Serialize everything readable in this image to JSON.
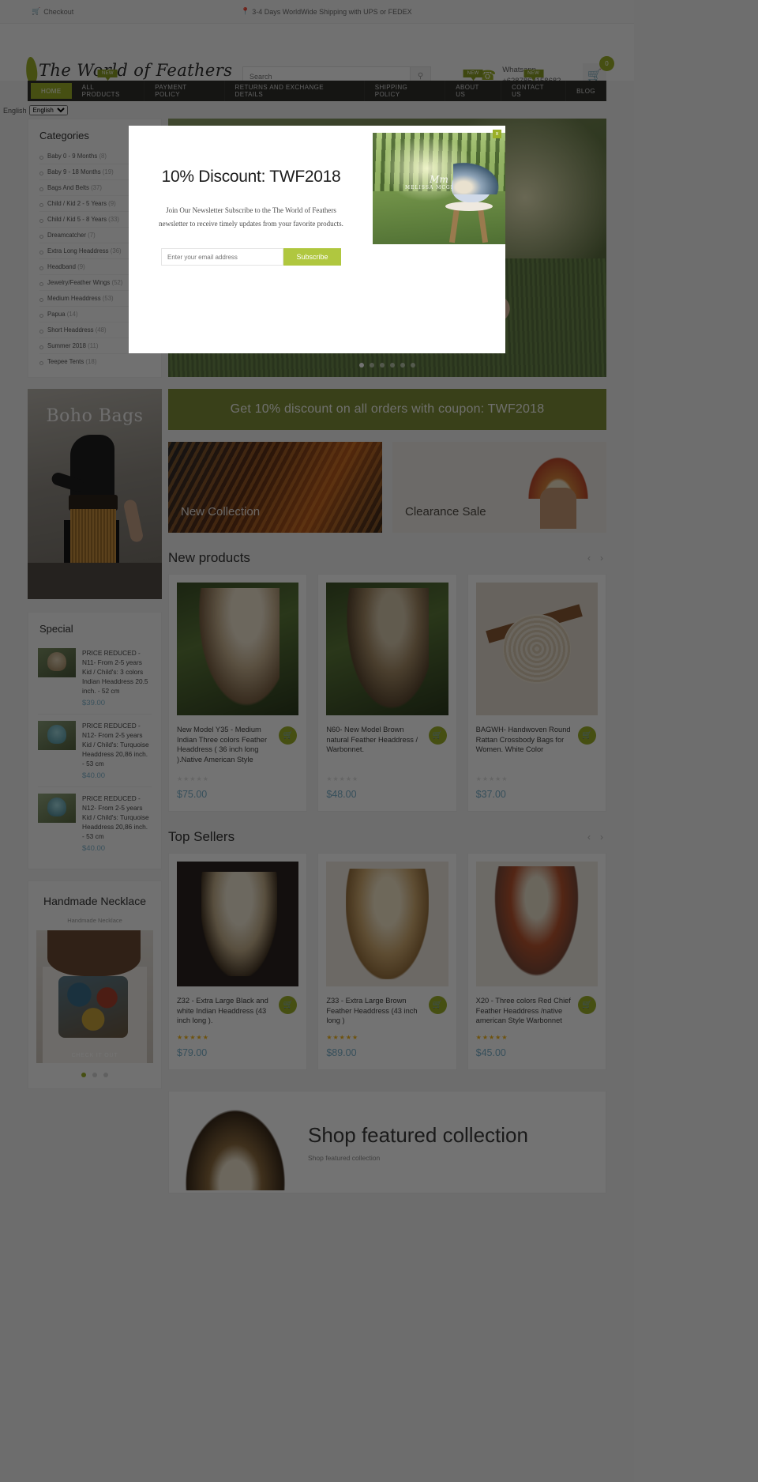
{
  "colors": {
    "accent": "#9bb029",
    "price": "#79b0cb",
    "nav_bg": "#2f2f2c",
    "subscribe": "#b0c73f"
  },
  "topbar": {
    "checkout": "Checkout",
    "shipping_notice": "3-4 Days WorldWide Shipping with UPS or FEDEX"
  },
  "header": {
    "brand": "The World of Feathers",
    "search_placeholder": "Search",
    "whatsapp_label": "Whatsapp",
    "whatsapp_number": "+6287862158682",
    "cart_count": "0"
  },
  "nav": {
    "items": [
      {
        "label": "HOME",
        "active": true,
        "flag": ""
      },
      {
        "label": "ALL PRODUCTS",
        "active": false,
        "flag": "NEW"
      },
      {
        "label": "PAYMENT POLICY",
        "active": false,
        "flag": ""
      },
      {
        "label": "RETURNS AND EXCHANGE DETAILS",
        "active": false,
        "flag": ""
      },
      {
        "label": "SHIPPING POLICY",
        "active": false,
        "flag": ""
      },
      {
        "label": "ABOUT US",
        "active": false,
        "flag": "NEW"
      },
      {
        "label": "CONTACT US",
        "active": false,
        "flag": "NEW"
      },
      {
        "label": "BLOG",
        "active": false,
        "flag": ""
      }
    ]
  },
  "language": {
    "label": "English",
    "options": [
      "English"
    ]
  },
  "sidebar": {
    "categories_title": "Categories",
    "categories": [
      {
        "label": "Baby 0 - 9 Months",
        "count": "(8)"
      },
      {
        "label": "Baby 9 - 18 Months",
        "count": "(19)"
      },
      {
        "label": "Bags And Belts",
        "count": "(37)"
      },
      {
        "label": "Child / Kid 2 - 5 Years",
        "count": "(9)"
      },
      {
        "label": "Child / Kid 5 - 8 Years",
        "count": "(33)"
      },
      {
        "label": "Dreamcatcher",
        "count": "(7)"
      },
      {
        "label": "Extra Long Headdress",
        "count": "(36)"
      },
      {
        "label": "Headband",
        "count": "(9)"
      },
      {
        "label": "Jewelry/Feather Wings",
        "count": "(52)"
      },
      {
        "label": "Medium Headdress",
        "count": "(53)"
      },
      {
        "label": "Papua",
        "count": "(14)"
      },
      {
        "label": "Short Headdress",
        "count": "(48)"
      },
      {
        "label": "Summer 2018",
        "count": "(11)"
      },
      {
        "label": "Teepee Tents",
        "count": "(18)"
      }
    ],
    "boho_banner": {
      "label": "Boho Bags"
    },
    "special_title": "Special",
    "special_items": [
      {
        "name": "PRICE REDUCED - N11- From 2-5 years Kid / Child's: 3 colors Indian Headdress 20.5 inch. - 52 cm",
        "price": "$39.00"
      },
      {
        "name": "PRICE REDUCED - N12- From 2-5 years Kid / Child's: Turquoise Headdress 20,86 inch. - 53 cm",
        "price": "$40.00"
      },
      {
        "name": "PRICE REDUCED - N12- From 2-5 years Kid / Child's: Turquoise Headdress 20,86 inch. - 53 cm",
        "price": "$40.00"
      }
    ],
    "necklace_block": {
      "title": "Handmade Necklace",
      "subtitle": "Handmade Necklace",
      "cta": "CHECK IT OUT",
      "dots": 3,
      "active_dot": 0
    }
  },
  "hero": {
    "slides": 6,
    "active_slide": 0
  },
  "coupon": {
    "text": "Get 10% discount on all orders with coupon: TWF2018"
  },
  "banners": [
    {
      "label": "New Collection"
    },
    {
      "label": "Clearance Sale"
    }
  ],
  "new_products": {
    "heading": "New products",
    "prev": "‹",
    "next": "›",
    "items": [
      {
        "title": "New Model Y35 - Medium Indian Three colors Feather Headdress ( 36 inch long ).Native American Style",
        "price": "$75.00",
        "rating": 0
      },
      {
        "title": "N60- New Model Brown natural Feather Headdress / Warbonnet.",
        "price": "$48.00",
        "rating": 0
      },
      {
        "title": "BAGWH- Handwoven Round Rattan Crossbody Bags for Women. White Color",
        "price": "$37.00",
        "rating": 0
      }
    ]
  },
  "top_sellers": {
    "heading": "Top Sellers",
    "prev": "‹",
    "next": "›",
    "items": [
      {
        "title": "Z32 - Extra Large Black and white Indian Headdress (43 inch long ).",
        "price": "$79.00",
        "rating": 5
      },
      {
        "title": "Z33 - Extra Large Brown Feather Headdress (43 inch long )",
        "price": "$89.00",
        "rating": 5
      },
      {
        "title": "X20 - Three colors Red Chief Feather Headdress /native american Style Warbonnet",
        "price": "$45.00",
        "rating": 5
      }
    ]
  },
  "featured": {
    "title": "Shop featured collection",
    "subtitle": "Shop featured collection"
  },
  "modal": {
    "heading": "10% Discount: TWF2018",
    "body": "Join Our Newsletter Subscribe to the The World of Feathers newsletter to receive timely updates from your favorite products.",
    "email_placeholder": "Enter your email address",
    "subscribe_label": "Subscribe",
    "close_label": "x",
    "image_watermark_script": "Mm",
    "image_watermark_name": "MELISSA MCGRANDE"
  }
}
